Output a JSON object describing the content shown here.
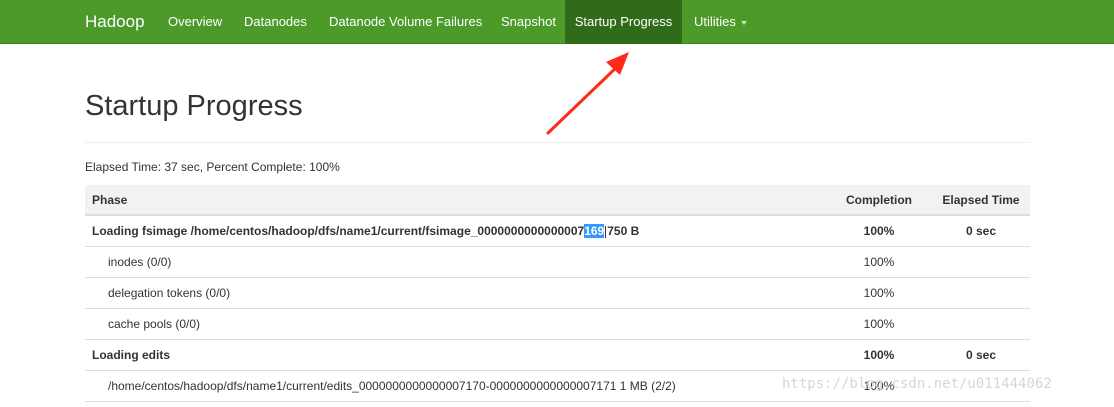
{
  "navbar": {
    "brand": "Hadoop",
    "items": [
      {
        "label": "Overview"
      },
      {
        "label": "Datanodes"
      },
      {
        "label": "Datanode Volume Failures"
      },
      {
        "label": "Snapshot"
      },
      {
        "label": "Startup Progress",
        "active": true
      },
      {
        "label": "Utilities",
        "dropdown": true
      }
    ]
  },
  "page": {
    "title": "Startup Progress",
    "summary": "Elapsed Time: 37 sec, Percent Complete: 100%"
  },
  "table": {
    "headers": {
      "phase": "Phase",
      "completion": "Completion",
      "elapsed": "Elapsed Time"
    },
    "rows": [
      {
        "kind": "phase",
        "phase_before": "Loading fsimage /home/centos/hadoop/dfs/name1/current/fsimage_0000000000000007",
        "phase_selected": "169",
        "phase_after": "750 B",
        "completion": "100%",
        "elapsed": "0 sec"
      },
      {
        "kind": "step",
        "phase": "inodes (0/0)",
        "completion": "100%",
        "elapsed": ""
      },
      {
        "kind": "step",
        "phase": "delegation tokens (0/0)",
        "completion": "100%",
        "elapsed": ""
      },
      {
        "kind": "step",
        "phase": "cache pools (0/0)",
        "completion": "100%",
        "elapsed": ""
      },
      {
        "kind": "phase",
        "phase": "Loading edits",
        "completion": "100%",
        "elapsed": "0 sec"
      },
      {
        "kind": "step",
        "phase": "/home/centos/hadoop/dfs/name1/current/edits_0000000000000007170-0000000000000007171 1 MB (2/2)",
        "completion": "100%",
        "elapsed": ""
      }
    ]
  },
  "watermark": "https://blog.csdn.net/u011444062",
  "colors": {
    "navbar": "#4b9a2a",
    "navbar_active": "#2f6b19",
    "annotation_arrow": "#ff2a1a",
    "selection": "#3399ff"
  }
}
